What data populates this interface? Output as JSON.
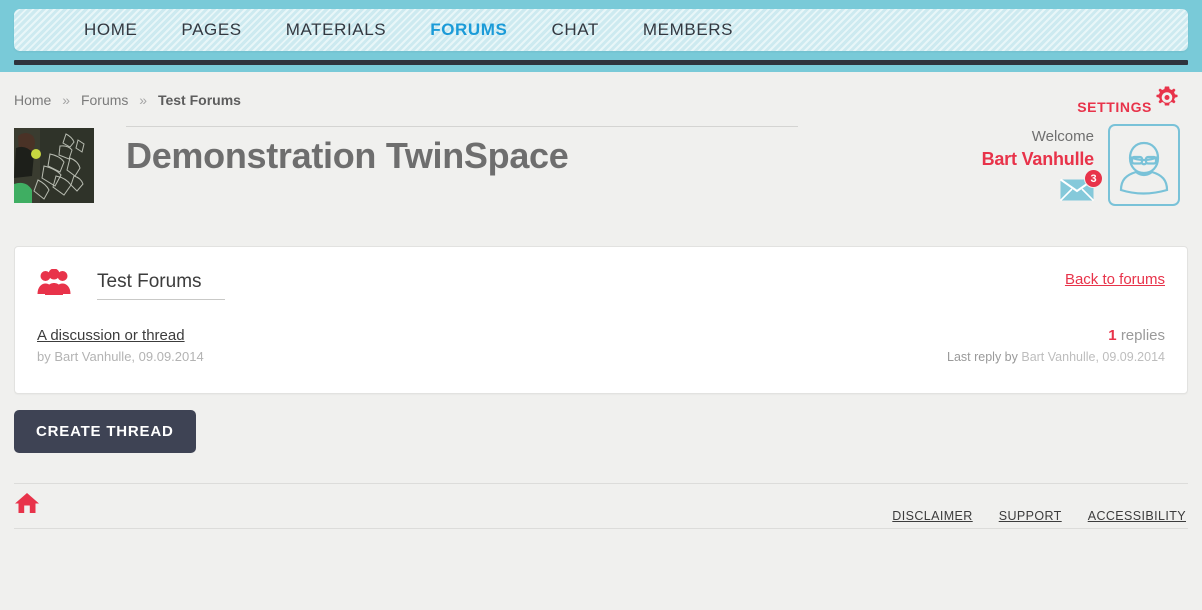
{
  "nav": {
    "items": [
      {
        "label": "HOME",
        "active": false
      },
      {
        "label": "PAGES",
        "active": false
      },
      {
        "label": "MATERIALS",
        "active": false
      },
      {
        "label": "FORUMS",
        "active": true
      },
      {
        "label": "CHAT",
        "active": false
      },
      {
        "label": "MEMBERS",
        "active": false
      }
    ]
  },
  "breadcrumb": {
    "items": [
      "Home",
      "Forums",
      "Test Forums"
    ],
    "separator": "»"
  },
  "settings": {
    "label": "SETTINGS",
    "icon": "gear-icon"
  },
  "header": {
    "title": "Demonstration TwinSpace",
    "thumbnail_alt": "twinspace-thumbnail"
  },
  "user": {
    "welcome_label": "Welcome",
    "name": "Bart Vanhulle",
    "mail_icon": "envelope-icon",
    "mail_count": "3",
    "avatar_icon": "user-avatar-icon"
  },
  "forum": {
    "name": "Test Forums",
    "group_icon": "group-people-icon",
    "back_link": "Back to forums",
    "threads": [
      {
        "title": "A discussion or thread",
        "author_line": "by Bart Vanhulle, 09.09.2014",
        "replies_count": "1",
        "replies_label": "replies",
        "last_reply_prefix": "Last reply by ",
        "last_reply_who": "Bart Vanhulle, 09.09.2014"
      }
    ]
  },
  "actions": {
    "create_thread": "CREATE THREAD"
  },
  "footer": {
    "home_icon": "home-icon",
    "links": [
      "DISCLAIMER",
      "SUPPORT",
      "ACCESSIBILITY"
    ]
  },
  "colors": {
    "accent_red": "#e8334a",
    "nav_band": "#79cad8",
    "nav_bar": "#cdeaf0",
    "active_tab": "#1b9bd8",
    "button_dark": "#3e4354",
    "page_bg": "#f0f0ee"
  }
}
